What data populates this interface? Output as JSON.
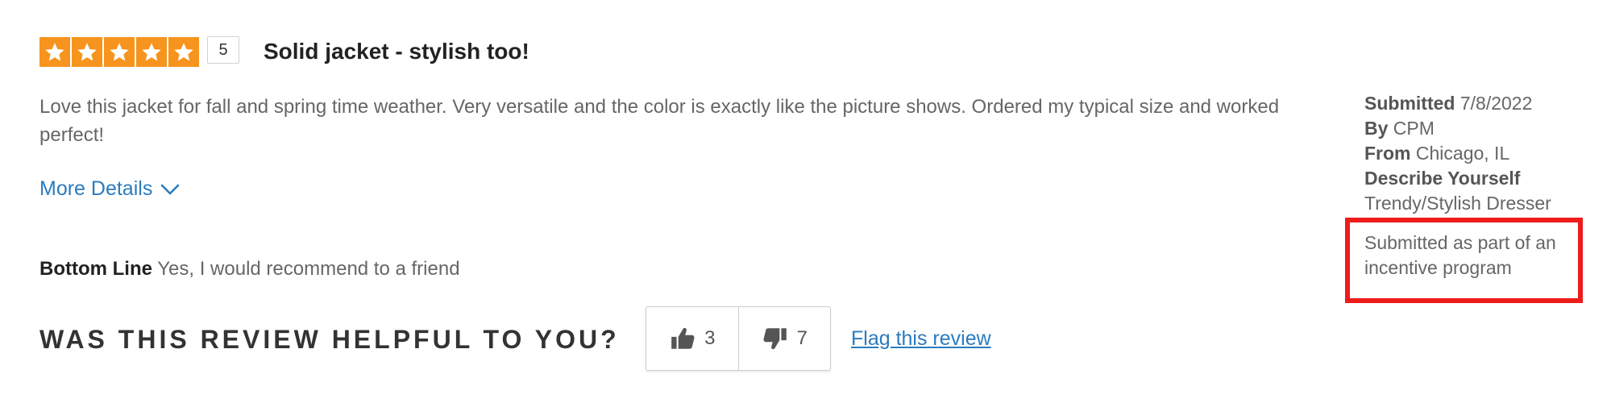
{
  "review": {
    "rating": 5,
    "rating_max": 5,
    "rating_label": "5",
    "title": "Solid jacket - stylish too!",
    "body": "Love this jacket for fall and spring time weather. Very versatile and the color is exactly like the picture shows. Ordered my typical size and worked perfect!",
    "more_details_label": "More Details",
    "bottom_line_label": "Bottom Line",
    "bottom_line_value": "Yes, I would recommend to a friend"
  },
  "meta": {
    "submitted_label": "Submitted",
    "submitted_value": "7/8/2022",
    "by_label": "By",
    "by_value": "CPM",
    "from_label": "From",
    "from_value": "Chicago, IL",
    "describe_label": "Describe Yourself",
    "describe_value": "Trendy/Stylish Dresser",
    "incentive_note": "Submitted as part of an incentive program"
  },
  "helpful": {
    "question": "WAS THIS REVIEW HELPFUL TO YOU?",
    "upvotes": "3",
    "downvotes": "7",
    "flag_label": "Flag this review"
  },
  "icons": {
    "star": "star-icon",
    "thumbs_up": "thumbs-up-icon",
    "thumbs_down": "thumbs-down-icon",
    "chevron": "chevron-down-icon"
  },
  "colors": {
    "star_fill": "#f7941d",
    "link": "#2a7bbf",
    "highlight_border": "#ee1b1b"
  }
}
